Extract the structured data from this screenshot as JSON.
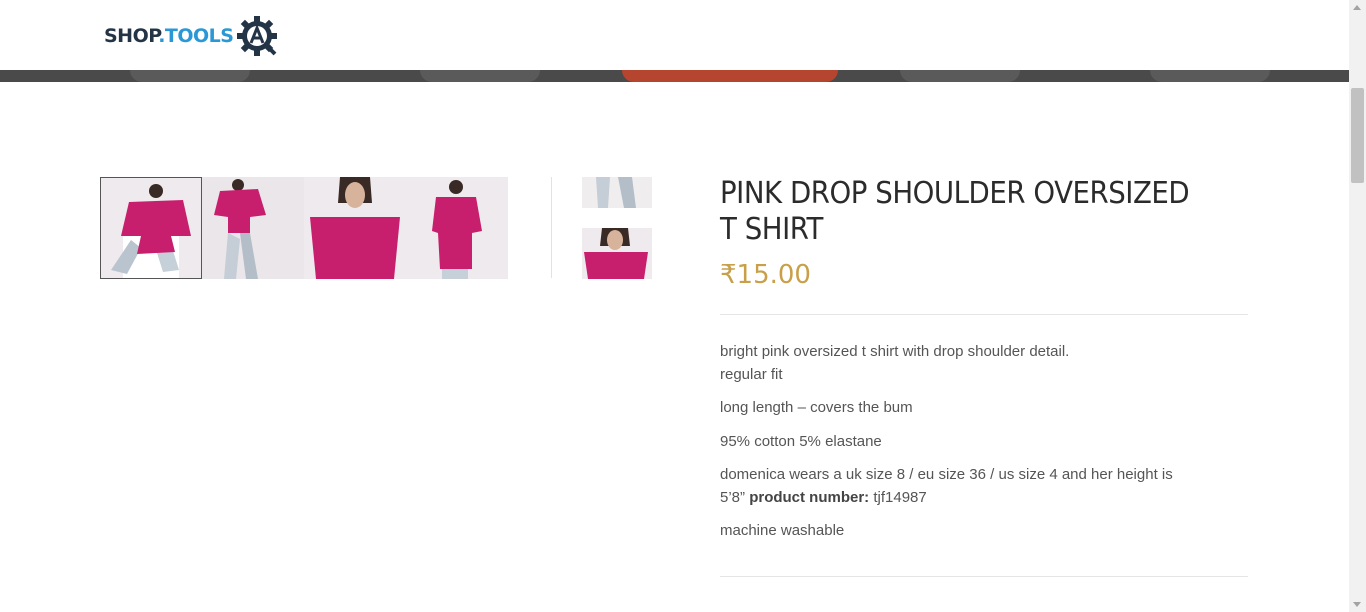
{
  "header": {
    "logo_text_shop": "SHOP",
    "logo_text_tools": ".TOOLS",
    "logo_icon": "gear-a-icon"
  },
  "gallery": {
    "thumbnails": [
      {
        "alt": "pink t shirt front seated"
      },
      {
        "alt": "pink t shirt standing"
      },
      {
        "alt": "pink t shirt close up"
      },
      {
        "alt": "pink t shirt side"
      }
    ],
    "vertical_thumbnails": [
      {
        "alt": "jeans detail"
      },
      {
        "alt": "pink t shirt close"
      }
    ]
  },
  "product": {
    "title": "PINK DROP SHOULDER OVERSIZED T SHIRT",
    "price": "₹15.00",
    "description": {
      "line1": "bright pink oversized t shirt with drop shoulder detail.",
      "line2": "regular fit",
      "line3": "long length – covers the bum",
      "line4": "95% cotton 5% elastane",
      "line5": "domenica wears a uk size 8 / eu size 36 / us size 4 and her height is 5’8”",
      "product_number_label": "product number:",
      "product_number": "tjf14987",
      "line6": "machine washable"
    }
  },
  "colors": {
    "price": "#c9a04a",
    "logo_blue": "#2a98d6",
    "logo_dark": "#243447",
    "shirt_pink": "#c71f6e"
  }
}
